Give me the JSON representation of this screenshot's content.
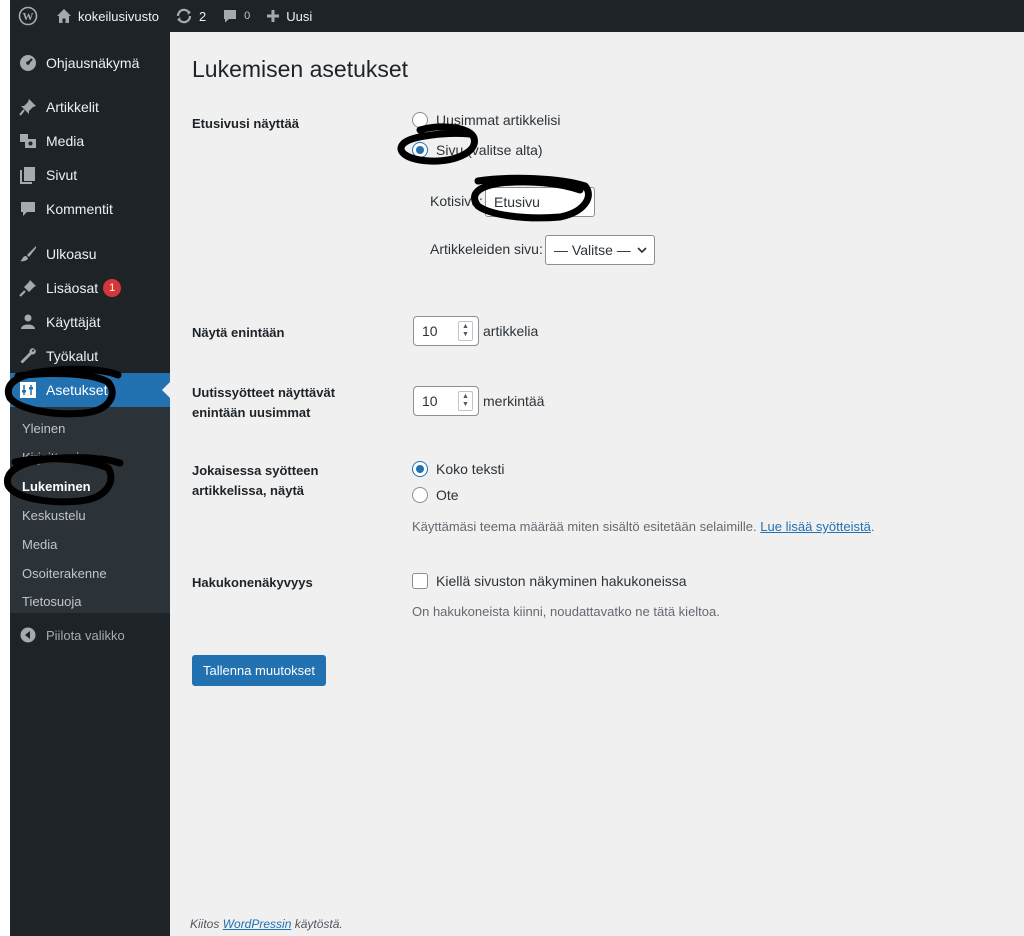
{
  "adminbar": {
    "site_name": "kokeilusivusto",
    "updates_count": "2",
    "comments_count": "0",
    "new_label": "Uusi"
  },
  "sidebar": {
    "items": [
      {
        "label": "Ohjausnäkymä",
        "icon": "dashboard-icon"
      },
      {
        "label": "Artikkelit",
        "icon": "pin-icon"
      },
      {
        "label": "Media",
        "icon": "media-icon"
      },
      {
        "label": "Sivut",
        "icon": "pages-icon"
      },
      {
        "label": "Kommentit",
        "icon": "comment-icon"
      },
      {
        "label": "Ulkoasu",
        "icon": "brush-icon"
      },
      {
        "label": "Lisäosat",
        "icon": "plugin-icon",
        "badge": "1"
      },
      {
        "label": "Käyttäjät",
        "icon": "users-icon"
      },
      {
        "label": "Työkalut",
        "icon": "wrench-icon"
      },
      {
        "label": "Asetukset",
        "icon": "settings-icon",
        "active": true
      }
    ],
    "submenu": [
      "Yleinen",
      "Kirjoittaminen",
      "Lukeminen",
      "Keskustelu",
      "Media",
      "Osoiterakenne",
      "Tietosuoja"
    ],
    "current_submenu": "Lukeminen",
    "collapse_label": "Piilota valikko"
  },
  "page": {
    "title": "Lukemisen asetukset",
    "front_page": {
      "label": "Etusivusi näyttää",
      "option_latest": "Uusimmat artikkelisi",
      "option_static": "Sivu (valitse alta)",
      "selected": "static",
      "homepage_label": "Kotisivu:",
      "homepage_value": "Etusivu",
      "posts_page_label": "Artikkeleiden sivu:",
      "posts_page_value": "— Valitse —"
    },
    "posts_per_page": {
      "label": "Näytä enintään",
      "value": "10",
      "unit": "artikkelia"
    },
    "feed_items": {
      "label": "Uutissyötteet näyttävät enintään uusimmat",
      "value": "10",
      "unit": "merkintää"
    },
    "feed_content": {
      "label": "Jokaisessa syötteen artikkelissa, näytä",
      "option_full": "Koko teksti",
      "option_excerpt": "Ote",
      "selected": "full",
      "description": "Käyttämäsi teema määrää miten sisältö esitetään selaimille.",
      "link_text": "Lue lisää syötteistä",
      "trailing": "."
    },
    "search_visibility": {
      "label": "Hakukonenäkyvyys",
      "checkbox_label": "Kiellä sivuston näkyminen hakukoneissa",
      "checked": false,
      "description": "On hakukoneista kiinni, noudattavatko ne tätä kieltoa."
    },
    "save_button": "Tallenna muutokset"
  },
  "footer": {
    "prefix": "Kiitos",
    "link": "WordPressin",
    "suffix": "käytöstä."
  },
  "colors": {
    "adminbar_bg": "#1d2327",
    "sidebar_bg": "#1d2327",
    "accent": "#2271b1",
    "content_bg": "#f0f0f1",
    "badge": "#d63638"
  }
}
